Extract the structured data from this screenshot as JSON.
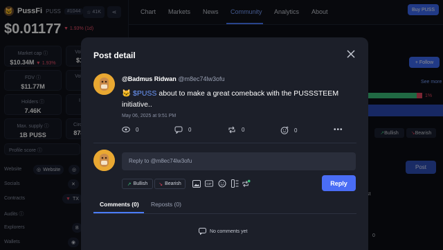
{
  "token": {
    "name": "PussFi",
    "symbol": "PUSS",
    "rank": "#1044",
    "watch_count": "41K",
    "price": "$0.01177",
    "change": "▼ 1.93% (1d)"
  },
  "stats": [
    {
      "label": "Market cap ⓘ",
      "value": "$10.34M",
      "change": "▼ 1.93%"
    },
    {
      "label": "Volu",
      "value": "$1",
      "change": ""
    },
    {
      "label": "FDV ⓘ",
      "value": "$11.77M",
      "change": ""
    },
    {
      "label": "Volu",
      "value": "",
      "change": ""
    },
    {
      "label": "Holders ⓘ",
      "value": "7.46K",
      "change": ""
    },
    {
      "label": "I",
      "value": "",
      "change": ""
    },
    {
      "label": "Max. supply ⓘ",
      "value": "1B PUSS",
      "change": ""
    },
    {
      "label": "Circul",
      "value": "878.",
      "change": ""
    }
  ],
  "profile_score": "Profile score ⓘ",
  "left_rows": {
    "website": "Website",
    "website_chip": "Website",
    "socials": "Socials",
    "contracts": "Contracts",
    "contracts_chip": "TX",
    "audits": "Audits ⓘ",
    "explorers": "Explorers",
    "explorers_chip": "B",
    "wallets": "Wallets"
  },
  "nav": {
    "tabs": [
      "Chart",
      "Markets",
      "News",
      "Community",
      "Analytics",
      "About"
    ],
    "active_tab": "Community",
    "buy_label": "Buy PUSS"
  },
  "background": {
    "follow_label": "+ Follow",
    "see_more": "See more",
    "bearish_pct": "1%",
    "bullish": "Bullish",
    "bearish": "Bearish",
    "post_label": "Post",
    "partial_text": "st",
    "partial_zero": "0"
  },
  "modal": {
    "title": "Post detail",
    "author_name": "@Badmus Ridwan",
    "author_handle": "@m8ec74lw3ofu",
    "post_ticker": "$PUSS",
    "post_body": " about to make a great comeback with the PUSSSTEEM initiative..",
    "post_date": "May 06, 2025 at 9:51 PM",
    "actions": {
      "views": "0",
      "comments": "0",
      "reposts": "0",
      "likes": "0"
    },
    "reply_placeholder": "Reply to @m8ec74lw3ofu",
    "bullish_label": "Bullish",
    "bearish_label": "Bearish",
    "reply_button": "Reply",
    "comment_tabs": [
      "Comments (0)",
      "Reposts (0)"
    ],
    "no_comments": "No comments yet"
  },
  "colors": {
    "accent": "#4a6df5",
    "down_red": "#f0516b",
    "up_green": "#3bbf7a",
    "avatar": "#e9a832"
  }
}
